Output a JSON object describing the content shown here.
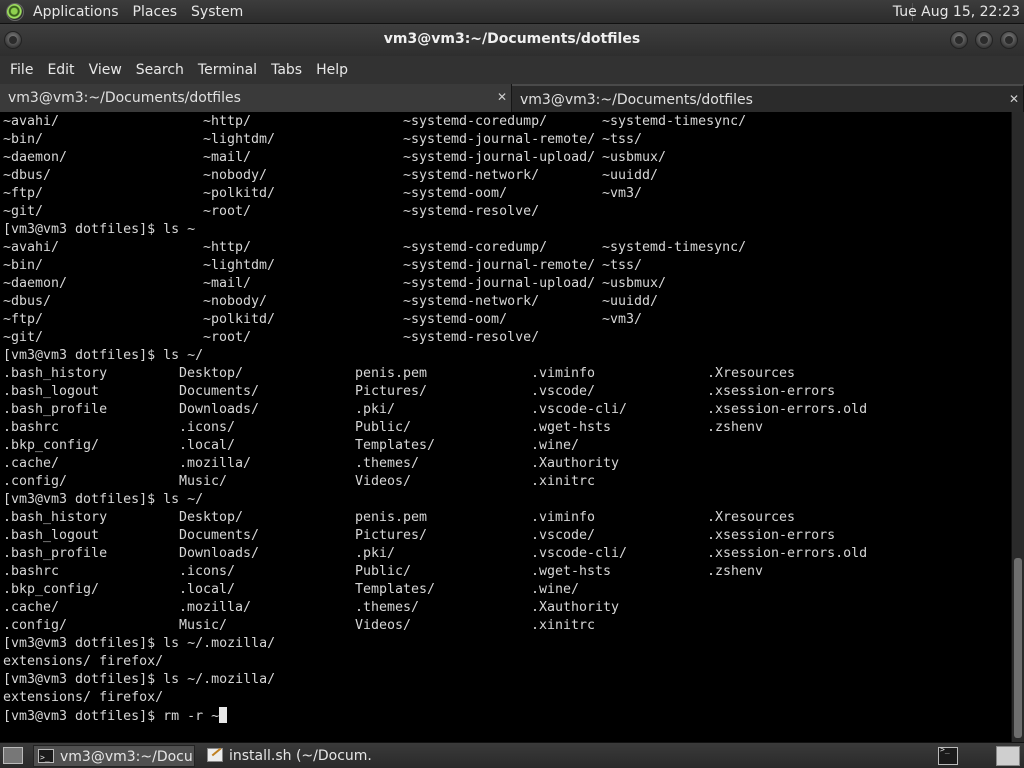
{
  "top_panel": {
    "menus": [
      "Applications",
      "Places",
      "System"
    ],
    "clock": "Tue Aug 15, 22:23"
  },
  "window": {
    "title": "vm3@vm3:~/Documents/dotfiles"
  },
  "menubar": [
    "File",
    "Edit",
    "View",
    "Search",
    "Terminal",
    "Tabs",
    "Help"
  ],
  "tabs": [
    {
      "label": "vm3@vm3:~/Documents/dotfiles",
      "close": "✕"
    },
    {
      "label": "vm3@vm3:~/Documents/dotfiles",
      "close": "✕"
    }
  ],
  "terminal": {
    "lines": [
      [
        "~avahi/",
        "~http/",
        "~systemd-coredump/",
        "~systemd-timesync/"
      ],
      [
        "~bin/",
        "~lightdm/",
        "~systemd-journal-remote/",
        "~tss/"
      ],
      [
        "~daemon/",
        "~mail/",
        "~systemd-journal-upload/",
        "~usbmux/"
      ],
      [
        "~dbus/",
        "~nobody/",
        "~systemd-network/",
        "~uuidd/"
      ],
      [
        "~ftp/",
        "~polkitd/",
        "~systemd-oom/",
        "~vm3/"
      ],
      [
        "~git/",
        "~root/",
        "~systemd-resolve/"
      ],
      [
        "[vm3@vm3 dotfiles]$ ls ~"
      ],
      [
        "~avahi/",
        "~http/",
        "~systemd-coredump/",
        "~systemd-timesync/"
      ],
      [
        "~bin/",
        "~lightdm/",
        "~systemd-journal-remote/",
        "~tss/"
      ],
      [
        "~daemon/",
        "~mail/",
        "~systemd-journal-upload/",
        "~usbmux/"
      ],
      [
        "~dbus/",
        "~nobody/",
        "~systemd-network/",
        "~uuidd/"
      ],
      [
        "~ftp/",
        "~polkitd/",
        "~systemd-oom/",
        "~vm3/"
      ],
      [
        "~git/",
        "~root/",
        "~systemd-resolve/"
      ],
      [
        "[vm3@vm3 dotfiles]$ ls ~/"
      ],
      [
        ".bash_history",
        "Desktop/",
        "penis.pem",
        ".viminfo",
        ".Xresources"
      ],
      [
        ".bash_logout",
        "Documents/",
        "Pictures/",
        ".vscode/",
        ".xsession-errors"
      ],
      [
        ".bash_profile",
        "Downloads/",
        ".pki/",
        ".vscode-cli/",
        ".xsession-errors.old"
      ],
      [
        ".bashrc",
        ".icons/",
        "Public/",
        ".wget-hsts",
        ".zshenv"
      ],
      [
        ".bkp_config/",
        ".local/",
        "Templates/",
        ".wine/"
      ],
      [
        ".cache/",
        ".mozilla/",
        ".themes/",
        ".Xauthority"
      ],
      [
        ".config/",
        "Music/",
        "Videos/",
        ".xinitrc"
      ],
      [
        "[vm3@vm3 dotfiles]$ ls ~/"
      ],
      [
        ".bash_history",
        "Desktop/",
        "penis.pem",
        ".viminfo",
        ".Xresources"
      ],
      [
        ".bash_logout",
        "Documents/",
        "Pictures/",
        ".vscode/",
        ".xsession-errors"
      ],
      [
        ".bash_profile",
        "Downloads/",
        ".pki/",
        ".vscode-cli/",
        ".xsession-errors.old"
      ],
      [
        ".bashrc",
        ".icons/",
        "Public/",
        ".wget-hsts",
        ".zshenv"
      ],
      [
        ".bkp_config/",
        ".local/",
        "Templates/",
        ".wine/"
      ],
      [
        ".cache/",
        ".mozilla/",
        ".themes/",
        ".Xauthority"
      ],
      [
        ".config/",
        "Music/",
        "Videos/",
        ".xinitrc"
      ],
      [
        "[vm3@vm3 dotfiles]$ ls ~/.mozilla/"
      ],
      [
        "extensions/ firefox/"
      ],
      [
        "[vm3@vm3 dotfiles]$ ls ~/.mozilla/"
      ],
      [
        "extensions/ firefox/"
      ]
    ],
    "current_prompt": "[vm3@vm3 dotfiles]$ rm -r ~"
  },
  "taskbar": {
    "items": [
      {
        "label": "vm3@vm3:~/Docu...",
        "icon": "terminal-icon",
        "active": true
      },
      {
        "label": "install.sh (~/Docum...",
        "icon": "text-editor-icon",
        "active": false
      }
    ]
  },
  "colors": {
    "terminal_bg": "#000000",
    "terminal_fg": "#d7d7d7",
    "panel_bg": "#2c2c2c"
  }
}
